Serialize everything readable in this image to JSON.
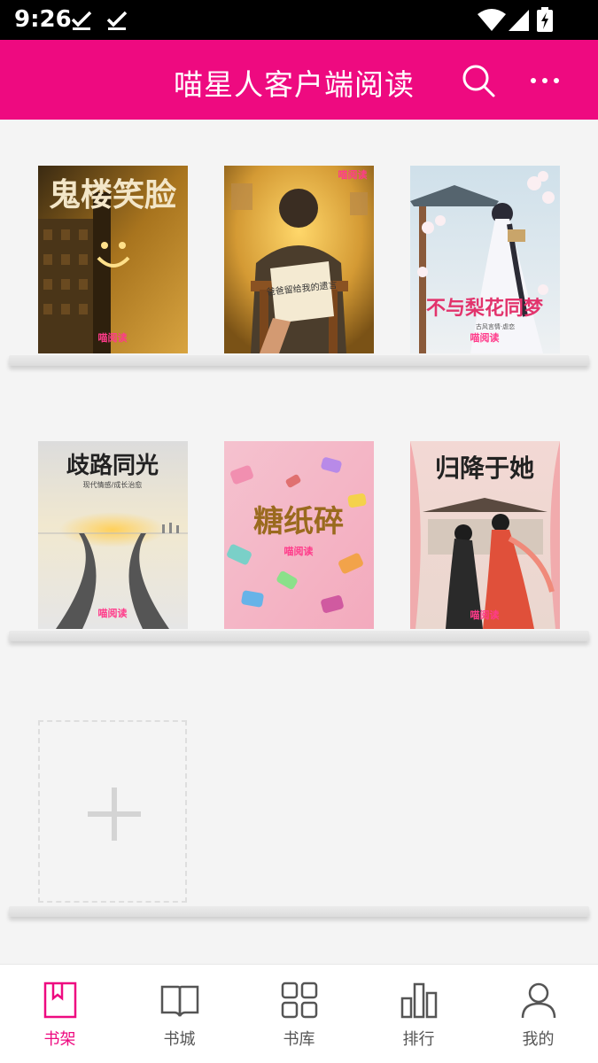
{
  "status_bar": {
    "time": "9:26",
    "icons": [
      "check-icon",
      "check-icon",
      "wifi-icon",
      "signal-icon",
      "battery-charging-icon"
    ]
  },
  "app_bar": {
    "title": "喵星人客户端阅读",
    "actions": [
      "search-icon",
      "more-icon"
    ],
    "background": "#ee0a80"
  },
  "bookshelf": {
    "books": [
      {
        "title": "鬼楼笑脸",
        "badge": "喵阅读"
      },
      {
        "title": "爸爸留给我的遗言",
        "badge": "喵阅读"
      },
      {
        "title": "不与梨花同梦",
        "subtitle": "古风言情·虐恋",
        "badge": "喵阅读"
      },
      {
        "title": "歧路同光",
        "subtitle": "现代情感/成长治愈"
      },
      {
        "title": "糖纸碎",
        "badge": "喵阅读"
      },
      {
        "title": "归降于她",
        "badge": "喵阅读"
      }
    ],
    "add_slot_icon": "plus-icon"
  },
  "bottom_nav": {
    "active_color": "#ee0a80",
    "items": [
      {
        "label": "书架",
        "icon": "bookmark-book-icon",
        "active": true
      },
      {
        "label": "书城",
        "icon": "open-book-icon",
        "active": false
      },
      {
        "label": "书库",
        "icon": "grid-icon",
        "active": false
      },
      {
        "label": "排行",
        "icon": "bar-chart-icon",
        "active": false
      },
      {
        "label": "我的",
        "icon": "person-icon",
        "active": false
      }
    ]
  }
}
